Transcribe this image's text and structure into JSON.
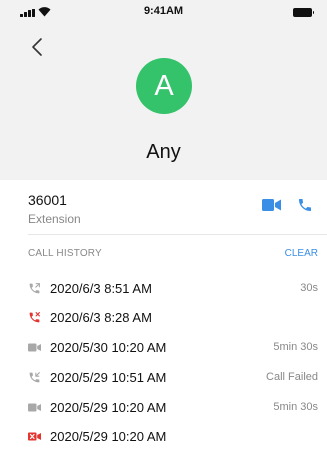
{
  "status_bar": {
    "time": "9:41AM"
  },
  "header": {
    "back_icon": "chevron-left-icon",
    "avatar_letter": "A",
    "avatar_color": "#34c26a",
    "contact_name": "Any"
  },
  "extension": {
    "number": "36001",
    "label": "Extension",
    "actions": [
      "video-call-icon",
      "phone-icon"
    ],
    "accent_color": "#3a8ee6"
  },
  "call_history": {
    "title": "CALL HISTORY",
    "clear_label": "CLEAR",
    "items": [
      {
        "icon": "outgoing-call-icon",
        "status": "normal",
        "date": "2020/6/3 8:51 AM",
        "info": "30s"
      },
      {
        "icon": "missed-call-icon",
        "status": "missed",
        "date": "2020/6/3 8:28 AM",
        "info": ""
      },
      {
        "icon": "video-call-icon",
        "status": "normal",
        "date": "2020/5/30 10:20 AM",
        "info": "5min 30s"
      },
      {
        "icon": "incoming-call-icon",
        "status": "normal",
        "date": "2020/5/29 10:51 AM",
        "info": "Call Failed"
      },
      {
        "icon": "video-call-icon",
        "status": "normal",
        "date": "2020/5/29 10:20 AM",
        "info": "5min 30s"
      },
      {
        "icon": "missed-video-call-icon",
        "status": "missed",
        "date": "2020/5/29 10:20 AM",
        "info": ""
      }
    ],
    "missed_color": "#e5332f",
    "normal_icon_color": "#a8a8a8"
  }
}
